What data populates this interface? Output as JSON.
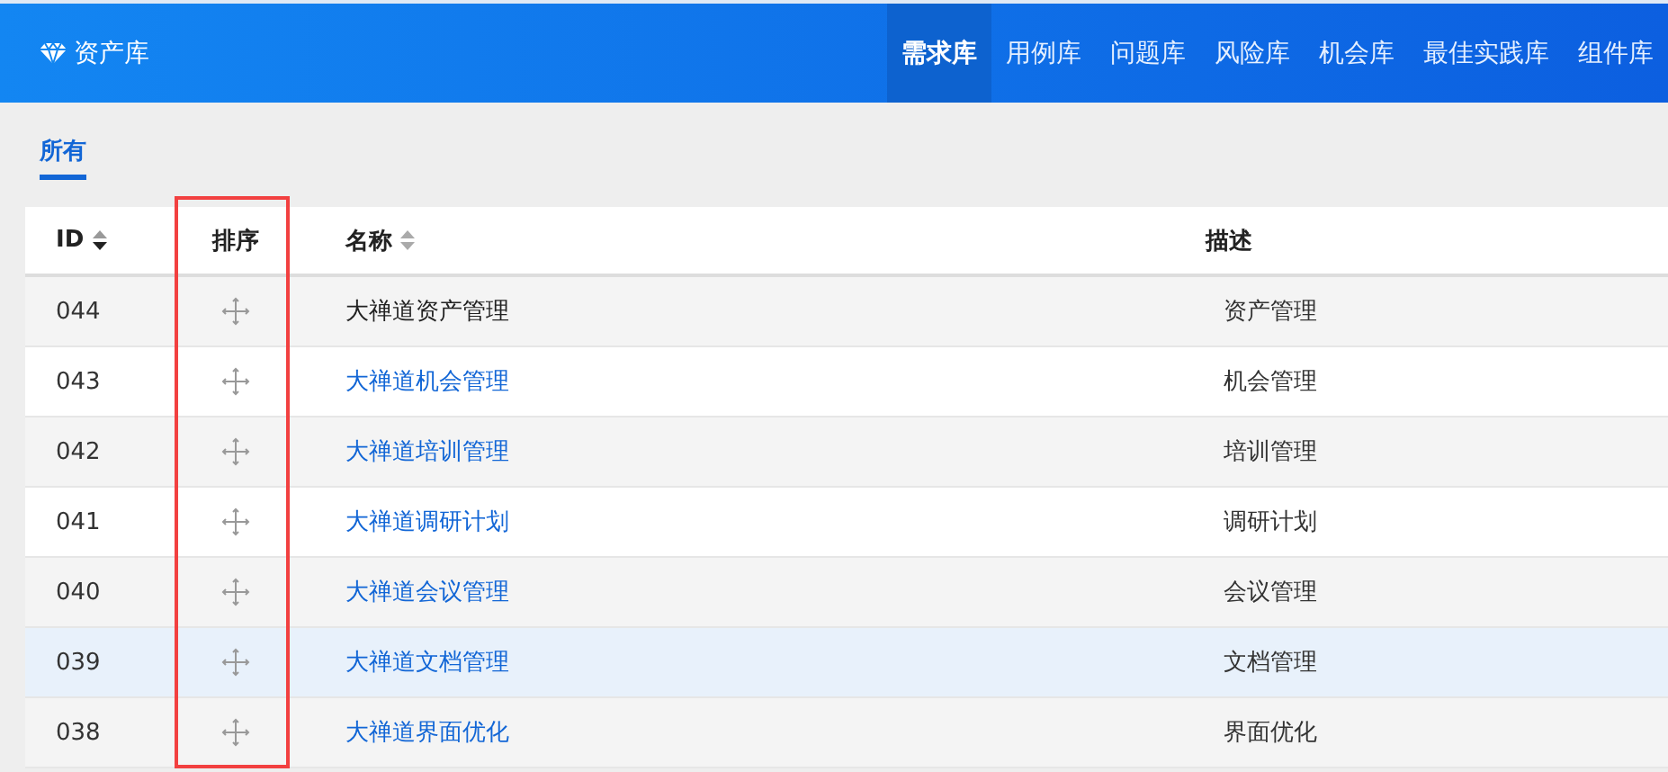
{
  "header": {
    "title": "资产库",
    "nav": [
      {
        "label": "需求库",
        "selected": true
      },
      {
        "label": "用例库",
        "selected": false
      },
      {
        "label": "问题库",
        "selected": false
      },
      {
        "label": "风险库",
        "selected": false
      },
      {
        "label": "机会库",
        "selected": false
      },
      {
        "label": "最佳实践库",
        "selected": false
      },
      {
        "label": "组件库",
        "selected": false
      }
    ]
  },
  "tabs": [
    {
      "label": "所有",
      "selected": true
    }
  ],
  "table": {
    "columns": [
      {
        "label": "ID",
        "sortable": true,
        "sorted_desc": true,
        "annotated": false
      },
      {
        "label": "排序",
        "sortable": false,
        "annotated": true
      },
      {
        "label": "名称",
        "sortable": true,
        "sorted_desc": false,
        "annotated": false
      },
      {
        "label": "描述",
        "sortable": false,
        "annotated": false
      }
    ],
    "rows": [
      {
        "id": "044",
        "name": "大禅道资产管理",
        "description": "资产管理",
        "visited": true,
        "selected": false
      },
      {
        "id": "043",
        "name": "大禅道机会管理",
        "description": "机会管理",
        "visited": false,
        "selected": false
      },
      {
        "id": "042",
        "name": "大禅道培训管理",
        "description": "培训管理",
        "visited": false,
        "selected": false
      },
      {
        "id": "041",
        "name": "大禅道调研计划",
        "description": "调研计划",
        "visited": false,
        "selected": false
      },
      {
        "id": "040",
        "name": "大禅道会议管理",
        "description": "会议管理",
        "visited": false,
        "selected": false
      },
      {
        "id": "039",
        "name": "大禅道文档管理",
        "description": "文档管理",
        "visited": false,
        "selected": true
      },
      {
        "id": "038",
        "name": "大禅道界面优化",
        "description": "界面优化",
        "visited": false,
        "selected": false
      }
    ]
  }
}
